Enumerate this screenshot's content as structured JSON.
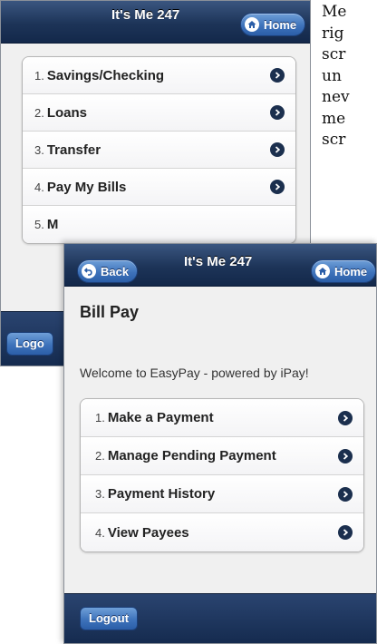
{
  "side_text_lines": [
    "Me",
    "rig",
    "scr",
    "un",
    "nev",
    "me",
    "scr"
  ],
  "back_screen": {
    "title": "It's Me 247",
    "home_label": "Home",
    "menu": [
      {
        "num": "1.",
        "label": "Savings/Checking"
      },
      {
        "num": "2.",
        "label": "Loans"
      },
      {
        "num": "3.",
        "label": "Transfer"
      },
      {
        "num": "4.",
        "label": "Pay My Bills"
      },
      {
        "num": "5.",
        "label": "M"
      }
    ],
    "logout_label": "Logo"
  },
  "front_screen": {
    "title": "It's Me 247",
    "back_label": "Back",
    "home_label": "Home",
    "heading": "Bill Pay",
    "welcome": "Welcome to EasyPay - powered by iPay!",
    "menu": [
      {
        "num": "1.",
        "label": "Make a Payment"
      },
      {
        "num": "2.",
        "label": "Manage Pending Payment"
      },
      {
        "num": "3.",
        "label": "Payment History"
      },
      {
        "num": "4.",
        "label": "View Payees"
      }
    ],
    "logout_label": "Logout"
  },
  "icons": {
    "home": "home-icon",
    "back": "back-arrow-icon",
    "chevron": "chevron-right-icon"
  },
  "colors": {
    "header_dark": "#1d3458",
    "button_blue": "#3e73bb",
    "chevron_bg": "#1b2f4e",
    "screen_bg": "#f0f0f0"
  }
}
